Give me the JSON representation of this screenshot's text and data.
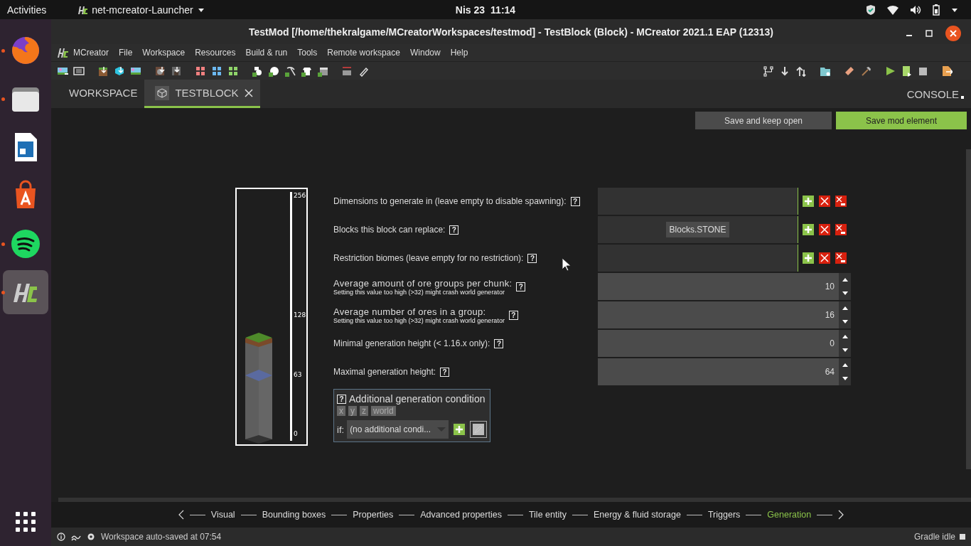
{
  "top_bar": {
    "activities": "Activities",
    "app_menu": "net-mcreator-Launcher",
    "date": "Nis 23",
    "time": "11:14"
  },
  "dock": {
    "items": [
      {
        "kind": "browser",
        "running": true,
        "selected": false
      },
      {
        "kind": "files",
        "running": true,
        "selected": false
      },
      {
        "kind": "writer",
        "running": false,
        "selected": false
      },
      {
        "kind": "store",
        "running": false,
        "selected": false
      },
      {
        "kind": "music",
        "running": true,
        "selected": false
      },
      {
        "kind": "mcreator",
        "running": true,
        "selected": true
      }
    ]
  },
  "window": {
    "title": "TestMod [/home/thekralgame/MCreatorWorkspaces/testmod] - TestBlock (Block) - MCreator 2021.1 EAP (12313)",
    "menu": [
      "MCreator",
      "File",
      "Workspace",
      "Resources",
      "Build & run",
      "Tools",
      "Remote workspace",
      "Window",
      "Help"
    ],
    "tabs": [
      {
        "kind": "workspace",
        "label": "WORKSPACE",
        "selected": false
      },
      {
        "kind": "element",
        "label": "TESTBLOCK",
        "selected": true
      }
    ],
    "console_tab": "CONSOLE"
  },
  "actions": [
    {
      "kind": "secondary",
      "label": "Save and keep open"
    },
    {
      "kind": "primary",
      "label": "Save mod element"
    }
  ],
  "height_scale": {
    "labels": [
      "256",
      "128",
      "63",
      "0"
    ]
  },
  "fields": [
    {
      "kind": "list",
      "label": "Dimensions to generate in (leave empty to disable spawning):",
      "help": "?"
    },
    {
      "kind": "list",
      "label": "Blocks this block can replace:",
      "help": "?",
      "tags": [
        "Blocks.STONE"
      ]
    },
    {
      "kind": "list",
      "label": "Restriction biomes (leave empty for no restriction):",
      "help": "?"
    },
    {
      "kind": "number",
      "label": "Average amount of ore groups per chunk:",
      "note": "Setting this value too high (>32) might crash world generator",
      "help": "?",
      "value": "10"
    },
    {
      "kind": "number",
      "label": "Average number of ores in a group:",
      "note": "Setting this value too high (>32) might crash world generator",
      "help": "?",
      "value": "16"
    },
    {
      "kind": "number",
      "label": "Minimal generation height (< 1.16.x only):",
      "help": "?",
      "value": "0"
    },
    {
      "kind": "number",
      "label": "Maximal generation height:",
      "help": "?",
      "value": "64"
    }
  ],
  "condition": {
    "help": "?",
    "title": "Additional generation condition",
    "params": [
      "x",
      "y",
      "z",
      "world"
    ],
    "if_label": "if:",
    "value": "(no additional condi..."
  },
  "steps": [
    {
      "label": "Visual",
      "selected": false
    },
    {
      "label": "Bounding boxes",
      "selected": false
    },
    {
      "label": "Properties",
      "selected": false
    },
    {
      "label": "Advanced properties",
      "selected": false
    },
    {
      "label": "Tile entity",
      "selected": false
    },
    {
      "label": "Energy & fluid storage",
      "selected": false
    },
    {
      "label": "Triggers",
      "selected": false
    },
    {
      "label": "Generation",
      "selected": true
    }
  ],
  "status_bar": {
    "message": "Workspace auto-saved at 07:54",
    "gradle": "Gradle idle"
  }
}
